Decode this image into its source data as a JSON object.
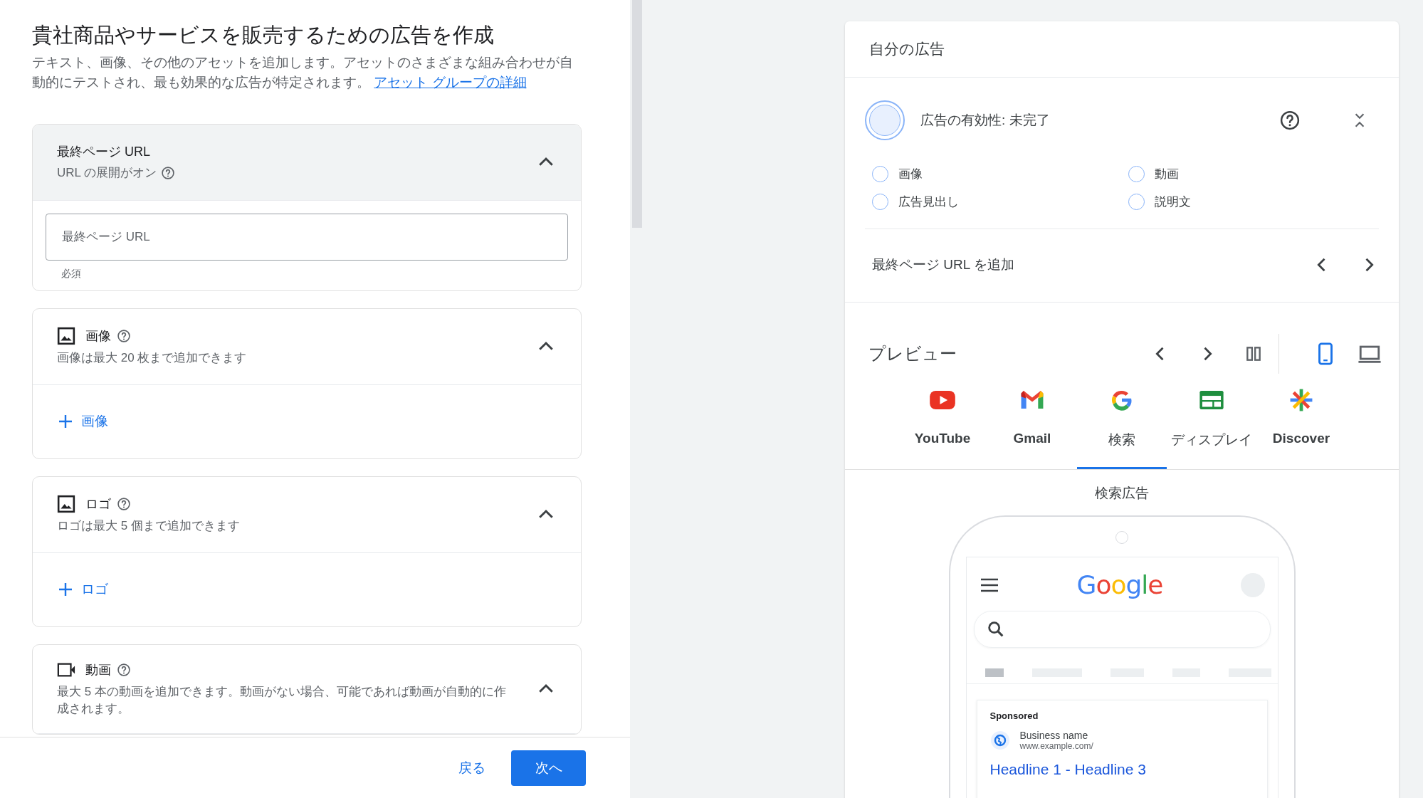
{
  "page": {
    "title": "貴社商品やサービスを販売するための広告を作成",
    "description": "テキスト、画像、その他のアセットを追加します。アセットのさまざまな組み合わせが自動的にテストされ、最も効果的な広告が特定されます。",
    "link": "アセット グループの詳細"
  },
  "sections": [
    {
      "kind": "url",
      "title": "最終ページ URL",
      "subtitle": "URL の展開がオン",
      "expanded": true,
      "field": {
        "placeholder": "最終ページ URL",
        "helper": "必須"
      }
    },
    {
      "kind": "image",
      "title": "画像",
      "subtitle": "画像は最大 20 枚まで追加できます",
      "expanded": true,
      "add_label": "画像"
    },
    {
      "kind": "logo",
      "title": "ロゴ",
      "subtitle": "ロゴは最大 5 個まで追加できます",
      "expanded": true,
      "add_label": "ロゴ"
    },
    {
      "kind": "video",
      "title": "動画",
      "subtitle": "最大 5 本の動画を追加できます。動画がない場合、可能であれば動画が自動的に作成されます。",
      "expanded": true
    }
  ],
  "footer": {
    "buttons": [
      {
        "label": "戻る",
        "kind": "text"
      },
      {
        "label": "次へ",
        "kind": "primary"
      }
    ]
  },
  "ad_panel": {
    "title": "自分の広告",
    "effectiveness": "広告の有効性: 未完了",
    "checklist": [
      {
        "label": "画像",
        "checked": false
      },
      {
        "label": "動画",
        "checked": false
      },
      {
        "label": "広告見出し",
        "checked": false
      },
      {
        "label": "説明文",
        "checked": false
      }
    ],
    "url_prompt": "最終ページ URL を追加",
    "preview_title": "プレビュー",
    "devices": [
      {
        "kind": "mobile",
        "selected": true
      },
      {
        "kind": "desktop",
        "selected": false
      }
    ],
    "channels": [
      {
        "kind": "youtube",
        "label": "YouTube",
        "selected": false
      },
      {
        "kind": "gmail",
        "label": "Gmail",
        "selected": false
      },
      {
        "kind": "search",
        "label": "検索",
        "selected": true
      },
      {
        "kind": "display",
        "label": "ディスプレイ",
        "selected": false
      },
      {
        "kind": "discover",
        "label": "Discover",
        "selected": false
      }
    ],
    "preview_label": "検索広告",
    "phone": {
      "logo": "Google",
      "sponsored": "Sponsored",
      "business": "Business name",
      "url": "www.example.com/",
      "headline": "Headline 1 - Headline 3"
    }
  }
}
